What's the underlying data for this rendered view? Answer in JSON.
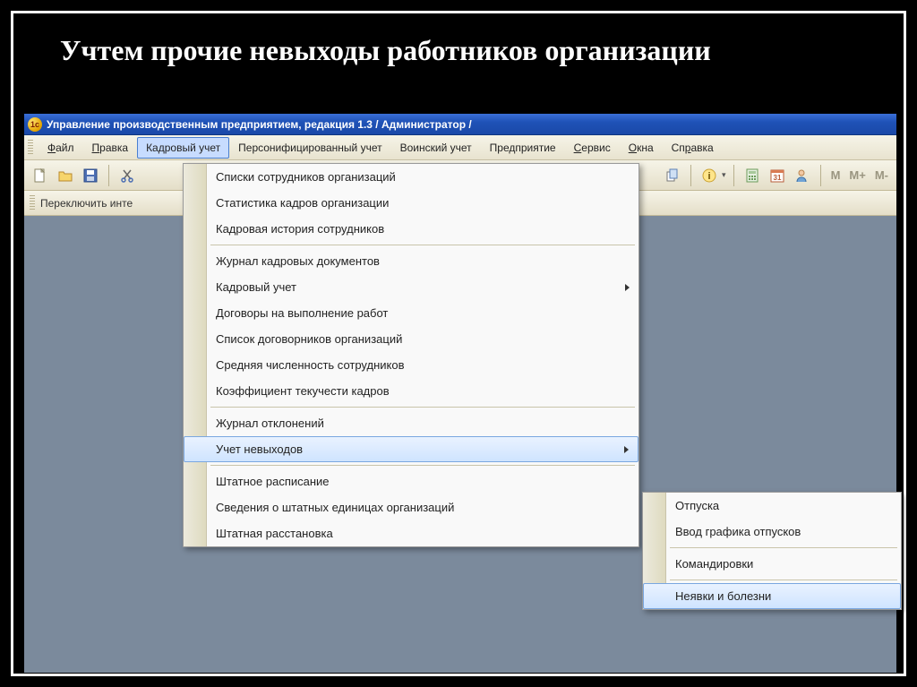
{
  "slide_title": "Учтем прочие невыходы работников организации",
  "titlebar": {
    "logo_text": "1c",
    "title": "Управление производственным предприятием, редакция 1.3 / Администратор /"
  },
  "menubar": {
    "file": "Файл",
    "edit": "Правка",
    "hr": "Кадровый учет",
    "pers": "Персонифицированный учет",
    "mil": "Воинский учет",
    "ent": "Предприятие",
    "svc": "Сервис",
    "win": "Окна",
    "help": "Справка"
  },
  "toolbar_text": {
    "m": "M",
    "mplus": "M+",
    "mminus": "M-"
  },
  "toolbar2": {
    "switch": "Переключить инте"
  },
  "dropdown_main": {
    "i0": "Списки сотрудников организаций",
    "i1": "Статистика кадров организации",
    "i2": "Кадровая история сотрудников",
    "i3": "Журнал кадровых документов",
    "i4": "Кадровый учет",
    "i5": "Договоры на выполнение работ",
    "i6": "Список договорников организаций",
    "i7": "Средняя численность сотрудников",
    "i8": "Коэффициент текучести кадров",
    "i9": "Журнал отклонений",
    "i10": "Учет невыходов",
    "i11": "Штатное расписание",
    "i12": "Сведения о штатных единицах организаций",
    "i13": "Штатная расстановка"
  },
  "dropdown_sub": {
    "s0": "Отпуска",
    "s1": "Ввод графика отпусков",
    "s2": "Командировки",
    "s3": "Неявки и болезни"
  }
}
